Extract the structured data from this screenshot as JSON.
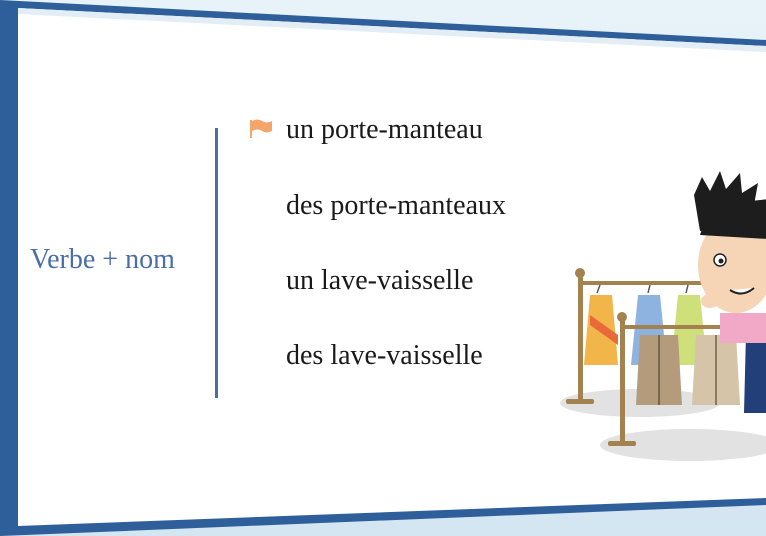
{
  "lesson": {
    "category_label": "Verbe + nom",
    "words": [
      "un porte-manteau",
      "des porte-manteaux",
      "un lave-vaisselle",
      "des lave-vaisselle"
    ],
    "active_index": 0
  },
  "colors": {
    "accent_blue": "#4a6ea8",
    "frame_blue": "#2e5f9a",
    "flag_orange": "#f4a56a",
    "text": "#1a1a1a"
  },
  "icons": [
    "flag-icon",
    "clothes-rack-illustration",
    "cartoon-character"
  ]
}
